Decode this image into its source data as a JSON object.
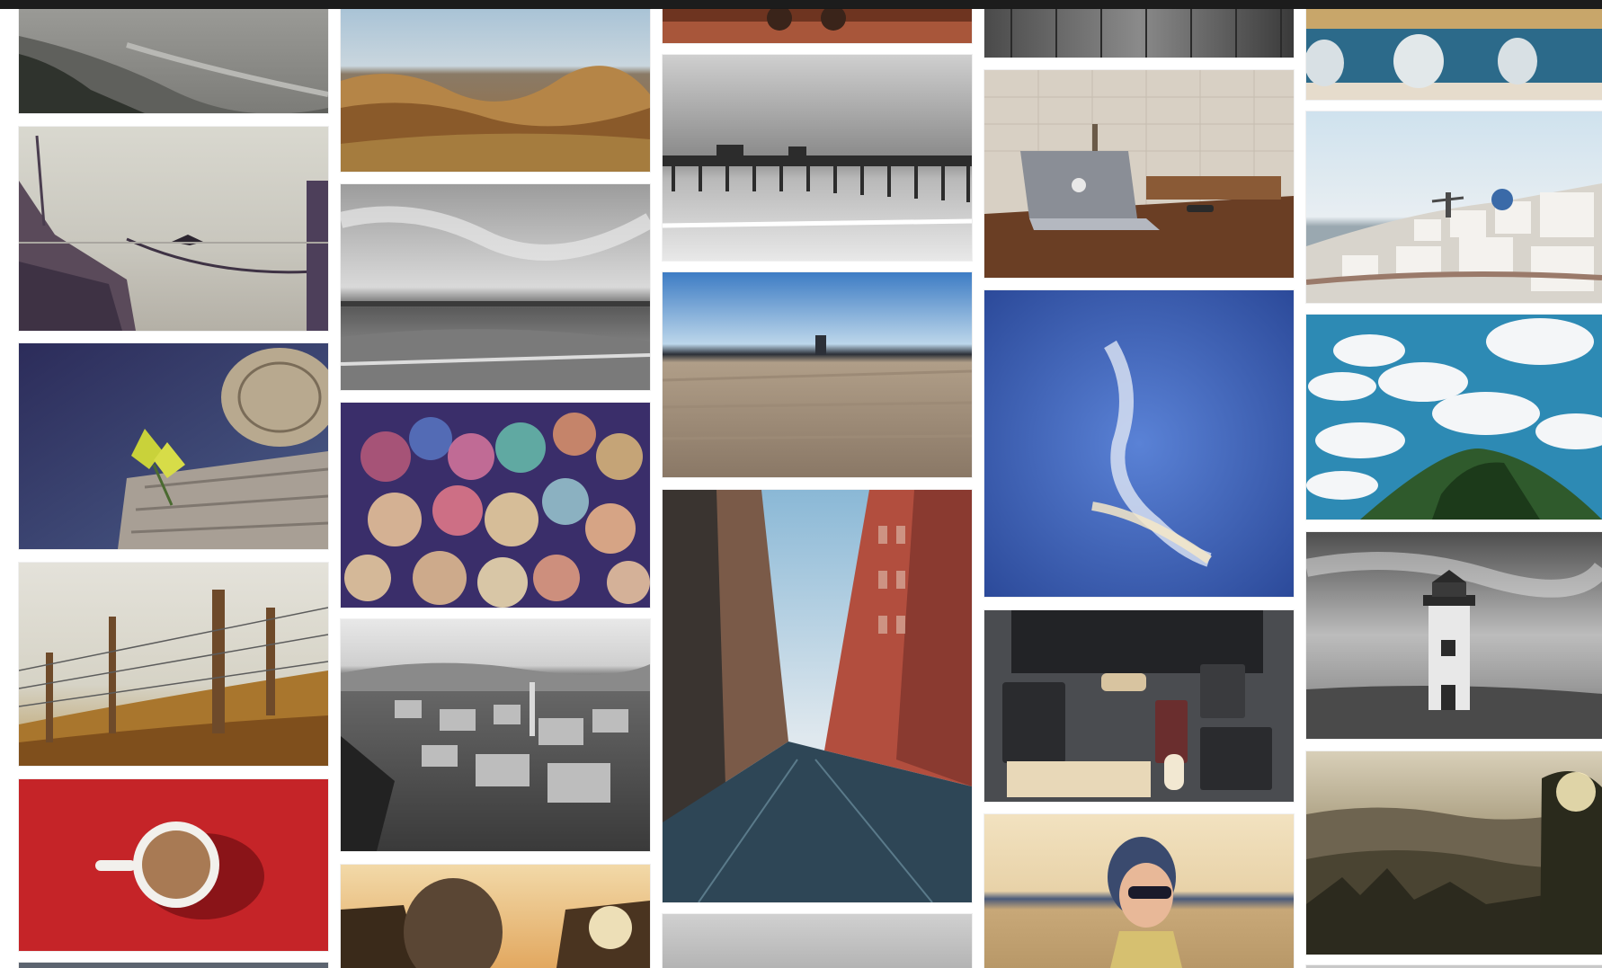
{
  "gallery": {
    "columns": [
      {
        "photos": [
          {
            "id": "coast-cliff",
            "alt": "coast-cliff"
          },
          {
            "id": "boat-bird",
            "alt": "boat-bird"
          },
          {
            "id": "leaf-log",
            "alt": "leaf-log"
          },
          {
            "id": "fence-field",
            "alt": "fence-field"
          },
          {
            "id": "coffee-cup",
            "alt": "coffee-cup"
          },
          {
            "id": "partial-bottom-1",
            "alt": "partial-bottom-1"
          }
        ]
      },
      {
        "photos": [
          {
            "id": "desert-dunes",
            "alt": "desert-dunes"
          },
          {
            "id": "bw-beach",
            "alt": "bw-beach"
          },
          {
            "id": "bokeh-lights",
            "alt": "bokeh-lights"
          },
          {
            "id": "bw-city",
            "alt": "bw-city"
          },
          {
            "id": "sunset-person",
            "alt": "sunset-person"
          }
        ]
      },
      {
        "photos": [
          {
            "id": "partial-top-3",
            "alt": "partial-top-3"
          },
          {
            "id": "pier",
            "alt": "pier"
          },
          {
            "id": "sand-beach",
            "alt": "sand-beach"
          },
          {
            "id": "city-street",
            "alt": "city-street"
          },
          {
            "id": "partial-bottom-3",
            "alt": "partial-bottom-3"
          }
        ]
      },
      {
        "photos": [
          {
            "id": "partial-top-4",
            "alt": "partial-top-4"
          },
          {
            "id": "laptop-desk",
            "alt": "laptop-desk"
          },
          {
            "id": "blue-sky-cloud",
            "alt": "blue-sky-cloud"
          },
          {
            "id": "workspace",
            "alt": "workspace"
          },
          {
            "id": "woman-sunglasses",
            "alt": "woman-sunglasses"
          }
        ]
      },
      {
        "photos": [
          {
            "id": "bottles",
            "alt": "bottles"
          },
          {
            "id": "santorini",
            "alt": "santorini"
          },
          {
            "id": "clouds-hill",
            "alt": "clouds-hill"
          },
          {
            "id": "lighthouse",
            "alt": "lighthouse"
          },
          {
            "id": "forest-sun",
            "alt": "forest-sun"
          }
        ]
      }
    ]
  }
}
